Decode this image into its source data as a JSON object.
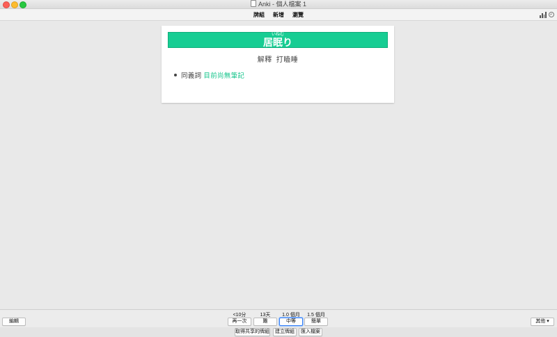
{
  "window": {
    "title": "Anki - 個人檔案 1"
  },
  "toolbar": {
    "decks": "牌組",
    "add": "新增",
    "browse": "瀏覽",
    "stats_icon": "stats-icon",
    "sync_icon": "sync-icon"
  },
  "card": {
    "furigana": "いねむ",
    "word": "居眠り",
    "meaning_label": "解釋",
    "meaning_value": "打瞌睡",
    "synonym_label": "同義詞",
    "synonym_value": "目前尚無筆記",
    "accent_color": "#17cd93"
  },
  "review_bar": {
    "edit": "編輯",
    "more": "其他",
    "answers": [
      {
        "interval": "<10分",
        "label": "再一次"
      },
      {
        "interval": "13天",
        "label": "難"
      },
      {
        "interval": "1.0 個月",
        "label": "中等"
      },
      {
        "interval": "1.5 個月",
        "label": "簡單"
      }
    ]
  },
  "footer": {
    "get_shared": "取得共享的牌組",
    "create_deck": "建立牌組",
    "import_file": "匯入檔案"
  }
}
